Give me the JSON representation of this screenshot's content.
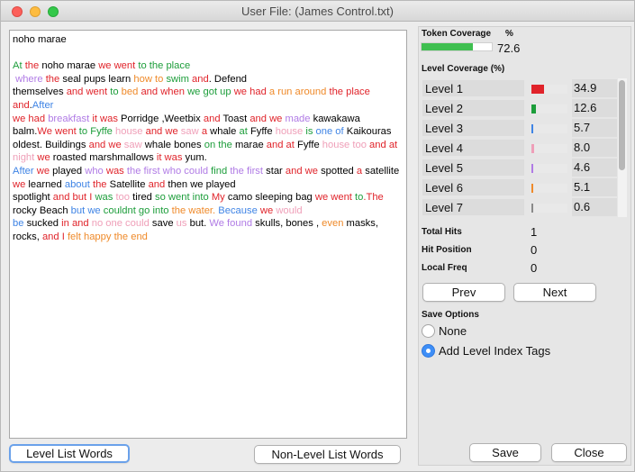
{
  "window": {
    "title": "User File: (James Control.txt)"
  },
  "text_lines": [
    [
      [
        "noho marae",
        "#000000"
      ]
    ],
    [],
    [
      [
        "At ",
        "#1c9d3a"
      ],
      [
        "the ",
        "#e0232a"
      ],
      [
        "noho marae ",
        "#000000"
      ],
      [
        "we went ",
        "#e0232a"
      ],
      [
        "to the place",
        "#1c9d3a"
      ]
    ],
    [
      [
        " where ",
        "#b07be5"
      ],
      [
        "the ",
        "#e0232a"
      ],
      [
        "seal pups learn ",
        "#000000"
      ],
      [
        "how to ",
        "#ef8a2a"
      ],
      [
        "swim ",
        "#1c9d3a"
      ],
      [
        "and",
        "#e0232a"
      ],
      [
        ". Defend",
        "#000000"
      ]
    ],
    [
      [
        "themselves ",
        "#000000"
      ],
      [
        "and went ",
        "#e0232a"
      ],
      [
        "to ",
        "#1c9d3a"
      ],
      [
        "bed ",
        "#ef8a2a"
      ],
      [
        "and when ",
        "#e0232a"
      ],
      [
        "we got up ",
        "#1c9d3a"
      ],
      [
        "we had ",
        "#e0232a"
      ],
      [
        "a run around ",
        "#ef8a2a"
      ],
      [
        "the place",
        "#e0232a"
      ]
    ],
    [
      [
        "and",
        "#e0232a"
      ],
      [
        ".",
        "#000000"
      ],
      [
        "After",
        "#3f84e5"
      ]
    ],
    [
      [
        "we had ",
        "#e0232a"
      ],
      [
        "breakfast ",
        "#b07be5"
      ],
      [
        "it was ",
        "#e0232a"
      ],
      [
        "Porridge ,Weetbix ",
        "#000000"
      ],
      [
        "and ",
        "#e0232a"
      ],
      [
        "Toast ",
        "#000000"
      ],
      [
        "and we ",
        "#e0232a"
      ],
      [
        "made ",
        "#b07be5"
      ],
      [
        "kawakawa",
        "#000000"
      ]
    ],
    [
      [
        "balm.",
        "#000000"
      ],
      [
        "We went ",
        "#e0232a"
      ],
      [
        "to Fyffe ",
        "#1c9d3a"
      ],
      [
        "house ",
        "#ef9fb8"
      ],
      [
        "and we ",
        "#e0232a"
      ],
      [
        "saw ",
        "#ef9fb8"
      ],
      [
        "a ",
        "#e0232a"
      ],
      [
        "whale ",
        "#000000"
      ],
      [
        "at ",
        "#1c9d3a"
      ],
      [
        "Fyffe ",
        "#000000"
      ],
      [
        "house ",
        "#ef9fb8"
      ],
      [
        "is ",
        "#1c9d3a"
      ],
      [
        "one of ",
        "#3f84e5"
      ],
      [
        "Kaikouras",
        "#000000"
      ]
    ],
    [
      [
        "oldest. Buildings ",
        "#000000"
      ],
      [
        "and we ",
        "#e0232a"
      ],
      [
        "saw ",
        "#ef9fb8"
      ],
      [
        "whale bones ",
        "#000000"
      ],
      [
        "on the ",
        "#1c9d3a"
      ],
      [
        "marae ",
        "#000000"
      ],
      [
        "and at ",
        "#e0232a"
      ],
      [
        "Fyffe ",
        "#000000"
      ],
      [
        "house too ",
        "#ef9fb8"
      ],
      [
        "and at",
        "#e0232a"
      ]
    ],
    [
      [
        "night ",
        "#ef9fb8"
      ],
      [
        "we ",
        "#e0232a"
      ],
      [
        "roasted marshmallows ",
        "#000000"
      ],
      [
        "it was ",
        "#e0232a"
      ],
      [
        "yum.",
        "#000000"
      ]
    ],
    [
      [
        "After ",
        "#3f84e5"
      ],
      [
        "we ",
        "#e0232a"
      ],
      [
        "played ",
        "#000000"
      ],
      [
        "who ",
        "#b07be5"
      ],
      [
        "was ",
        "#e0232a"
      ],
      [
        "the first who could ",
        "#b07be5"
      ],
      [
        "find ",
        "#1c9d3a"
      ],
      [
        "the first ",
        "#b07be5"
      ],
      [
        "star ",
        "#000000"
      ],
      [
        "and we ",
        "#e0232a"
      ],
      [
        "spotted ",
        "#000000"
      ],
      [
        "a ",
        "#e0232a"
      ],
      [
        "satellite",
        "#000000"
      ]
    ],
    [
      [
        "we ",
        "#e0232a"
      ],
      [
        "learned ",
        "#000000"
      ],
      [
        "about ",
        "#3f84e5"
      ],
      [
        "the ",
        "#e0232a"
      ],
      [
        "Satellite ",
        "#000000"
      ],
      [
        "and ",
        "#e0232a"
      ],
      [
        "then we played",
        "#000000"
      ]
    ],
    [
      [
        "spotlight ",
        "#000000"
      ],
      [
        "and but I ",
        "#e0232a"
      ],
      [
        "was ",
        "#1c9d3a"
      ],
      [
        "too ",
        "#ef9fb8"
      ],
      [
        "tired ",
        "#000000"
      ],
      [
        "so went into ",
        "#1c9d3a"
      ],
      [
        "My ",
        "#e0232a"
      ],
      [
        "camo sleeping bag ",
        "#000000"
      ],
      [
        "we went ",
        "#e0232a"
      ],
      [
        "to",
        "#1c9d3a"
      ],
      [
        ".The",
        "#e0232a"
      ]
    ],
    [
      [
        "rocky Beach ",
        "#000000"
      ],
      [
        "but we ",
        "#3f84e5"
      ],
      [
        "couldnt go into ",
        "#1c9d3a"
      ],
      [
        "the water. ",
        "#ef8a2a"
      ],
      [
        "Because ",
        "#3f84e5"
      ],
      [
        "we ",
        "#e0232a"
      ],
      [
        "would",
        "#ef9fb8"
      ]
    ],
    [
      [
        "be ",
        "#3f84e5"
      ],
      [
        "sucked ",
        "#000000"
      ],
      [
        "in and ",
        "#e0232a"
      ],
      [
        "no one could ",
        "#ef9fb8"
      ],
      [
        "save ",
        "#000000"
      ],
      [
        "us ",
        "#ef9fb8"
      ],
      [
        "but. ",
        "#000000"
      ],
      [
        "We found ",
        "#b07be5"
      ],
      [
        "skulls, bones , ",
        "#000000"
      ],
      [
        "even ",
        "#ef8a2a"
      ],
      [
        "masks,",
        "#000000"
      ]
    ],
    [
      [
        "rocks, ",
        "#000000"
      ],
      [
        "and I ",
        "#e0232a"
      ],
      [
        "felt happy ",
        "#ef8a2a"
      ],
      [
        "the end",
        "#ef8a2a"
      ]
    ]
  ],
  "buttons": {
    "level_list": "Level List Words",
    "non_level_list": "Non-Level List Words",
    "prev": "Prev",
    "next": "Next",
    "save": "Save",
    "close": "Close"
  },
  "token_coverage": {
    "label": "Token Coverage",
    "percent_label": "%",
    "value": "72.6",
    "fraction": 0.726,
    "color": "#3fbf50"
  },
  "level_coverage": {
    "label": "Level Coverage (%)",
    "levels": [
      {
        "name": "Level 1",
        "value": "34.9",
        "fraction": 0.349,
        "color": "#e0232a"
      },
      {
        "name": "Level 2",
        "value": "12.6",
        "fraction": 0.126,
        "color": "#1c9d3a"
      },
      {
        "name": "Level 3",
        "value": "5.7",
        "fraction": 0.057,
        "color": "#3f84e5"
      },
      {
        "name": "Level 4",
        "value": "8.0",
        "fraction": 0.08,
        "color": "#ef9fb8"
      },
      {
        "name": "Level 5",
        "value": "4.6",
        "fraction": 0.046,
        "color": "#b07be5"
      },
      {
        "name": "Level 6",
        "value": "5.1",
        "fraction": 0.051,
        "color": "#ef8a2a"
      },
      {
        "name": "Level 7",
        "value": "0.6",
        "fraction": 0.006,
        "color": "#8a8a8a"
      }
    ]
  },
  "stats": {
    "total_hits_label": "Total Hits",
    "total_hits": "1",
    "hit_position_label": "Hit Position",
    "hit_position": "0",
    "local_freq_label": "Local Freq",
    "local_freq": "0"
  },
  "save_options": {
    "label": "Save Options",
    "none_label": "None",
    "tags_label": "Add Level Index Tags",
    "selected": "tags"
  }
}
